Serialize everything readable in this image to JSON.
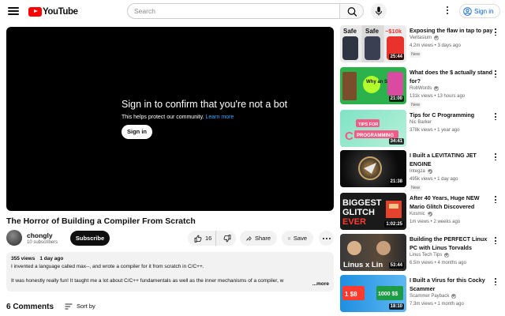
{
  "header": {
    "logo_text": "YouTube",
    "logo_country": "JP",
    "search_placeholder": "Search",
    "signin_label": "Sign in"
  },
  "player": {
    "bot_title": "Sign in to confirm that you're not a bot",
    "bot_subtitle": "This helps protect our community.",
    "learn_more": "Learn more",
    "signin_button": "Sign in"
  },
  "video": {
    "title": "The Horror of Building a Compiler From Scratch",
    "channel": "chongly",
    "subscribers": "10 subscribers",
    "subscribe_label": "Subscribe",
    "likes": "16",
    "share_label": "Share",
    "save_label": "Save"
  },
  "description": {
    "views": "355 views",
    "date": "1 day ago",
    "line1": "I invented a language called max--, and wrote a compiler for it from scratch in C/C++.",
    "line2": "It was honestly really fun! It taught me a lot about C/C++ fundamentals as well as the inner mechanisms of a compiler, w",
    "more": "...more"
  },
  "comments": {
    "count_label": "6 Comments",
    "sort_label": "Sort by"
  },
  "recommendations": [
    {
      "title": "Exposing the flaw in tap to pay",
      "channel": "Veritasium",
      "verified": true,
      "meta": "4.2m views • 3 days ago",
      "badge": "New",
      "duration": "25:44",
      "thumb_text": [
        "Safe",
        "Safe",
        "~$10k"
      ]
    },
    {
      "title": "What does the $ actually stand for?",
      "channel": "RobWords",
      "verified": true,
      "meta": "131k views • 13 hours ago",
      "badge": "New",
      "duration": "21:00",
      "thumb_text": [
        "Why an S?"
      ]
    },
    {
      "title": "Tips for C Programming",
      "channel": "Nic Barker",
      "verified": false,
      "meta": "378k views • 1 year ago",
      "badge": "",
      "duration": "34:41",
      "thumb_text": [
        "TIPS FOR",
        "PROGRAMMING"
      ]
    },
    {
      "title": "I Built a LEVITATING JET ENGINE",
      "channel": "Integza",
      "verified": true,
      "meta": "495k views • 1 day ago",
      "badge": "New",
      "duration": "21:38",
      "thumb_text": []
    },
    {
      "title": "After 40 Years, Huge NEW Mario Glitch Discovered",
      "channel": "Kosmic",
      "verified": true,
      "meta": "1m views • 2 weeks ago",
      "badge": "",
      "duration": "1:02:25",
      "thumb_text": [
        "BIGGEST",
        "GLITCH",
        "EVER"
      ]
    },
    {
      "title": "Building the PERFECT Linux PC with Linus Torvalds",
      "channel": "Linus Tech Tips",
      "verified": true,
      "meta": "6.5m views • 4 months ago",
      "badge": "",
      "duration": "53:44",
      "thumb_text": [
        "Linus x Lin"
      ]
    },
    {
      "title": "I Built a Virus for this Cocky Scammer",
      "channel": "Scammer Payback",
      "verified": true,
      "meta": "7.3m views • 1 month ago",
      "badge": "",
      "duration": "18:10",
      "thumb_text": [
        "1 $8",
        "1000 $$"
      ]
    }
  ],
  "colors": {
    "brand_red": "#ff0000",
    "link_blue": "#065fd4",
    "player_link": "#3ea6ff"
  }
}
